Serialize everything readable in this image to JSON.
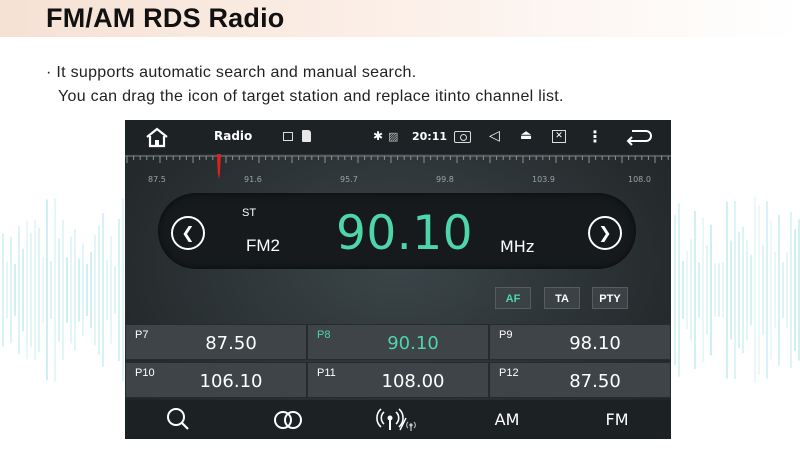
{
  "page": {
    "title": "FM/AM RDS Radio",
    "description_line1": "· It supports automatic search and manual search.",
    "description_line2": "You can drag the icon of target station and replace itinto channel list."
  },
  "statusbar": {
    "app_title": "Radio",
    "time": "20:11",
    "icons": [
      "home-icon",
      "image-icon",
      "sd-card-icon",
      "bluetooth-icon",
      "no-signal-icon",
      "camera-icon",
      "volume-icon",
      "eject-icon",
      "close-window-icon",
      "menu-icon",
      "back-icon"
    ]
  },
  "tuner": {
    "scale_labels": [
      "87.5",
      "91.6",
      "95.7",
      "99.8",
      "103.9",
      "108.0"
    ],
    "stereo": "ST",
    "band": "FM2",
    "frequency": "90.10",
    "unit": "MHz",
    "needle_frequency": 90.1,
    "scale_min": 87.5,
    "scale_max": 108.0
  },
  "modes": {
    "af": "AF",
    "ta": "TA",
    "pty": "PTY",
    "active_color": "#4fd6a8"
  },
  "presets": [
    {
      "num": "P7",
      "value": "87.50",
      "active": false
    },
    {
      "num": "P8",
      "value": "90.10",
      "active": true
    },
    {
      "num": "P9",
      "value": "98.10",
      "active": false
    },
    {
      "num": "P10",
      "value": "106.10",
      "active": false
    },
    {
      "num": "P11",
      "value": "108.00",
      "active": false
    },
    {
      "num": "P12",
      "value": "87.50",
      "active": false
    }
  ],
  "bottombar": {
    "search_icon": "search-icon",
    "stereo_icon": "stereo-rings-icon",
    "rds_icon": "rds-signal-icon",
    "am_label": "AM",
    "fm_label": "FM"
  },
  "colors": {
    "accent": "#4fd6a8",
    "needle": "#e02020"
  }
}
